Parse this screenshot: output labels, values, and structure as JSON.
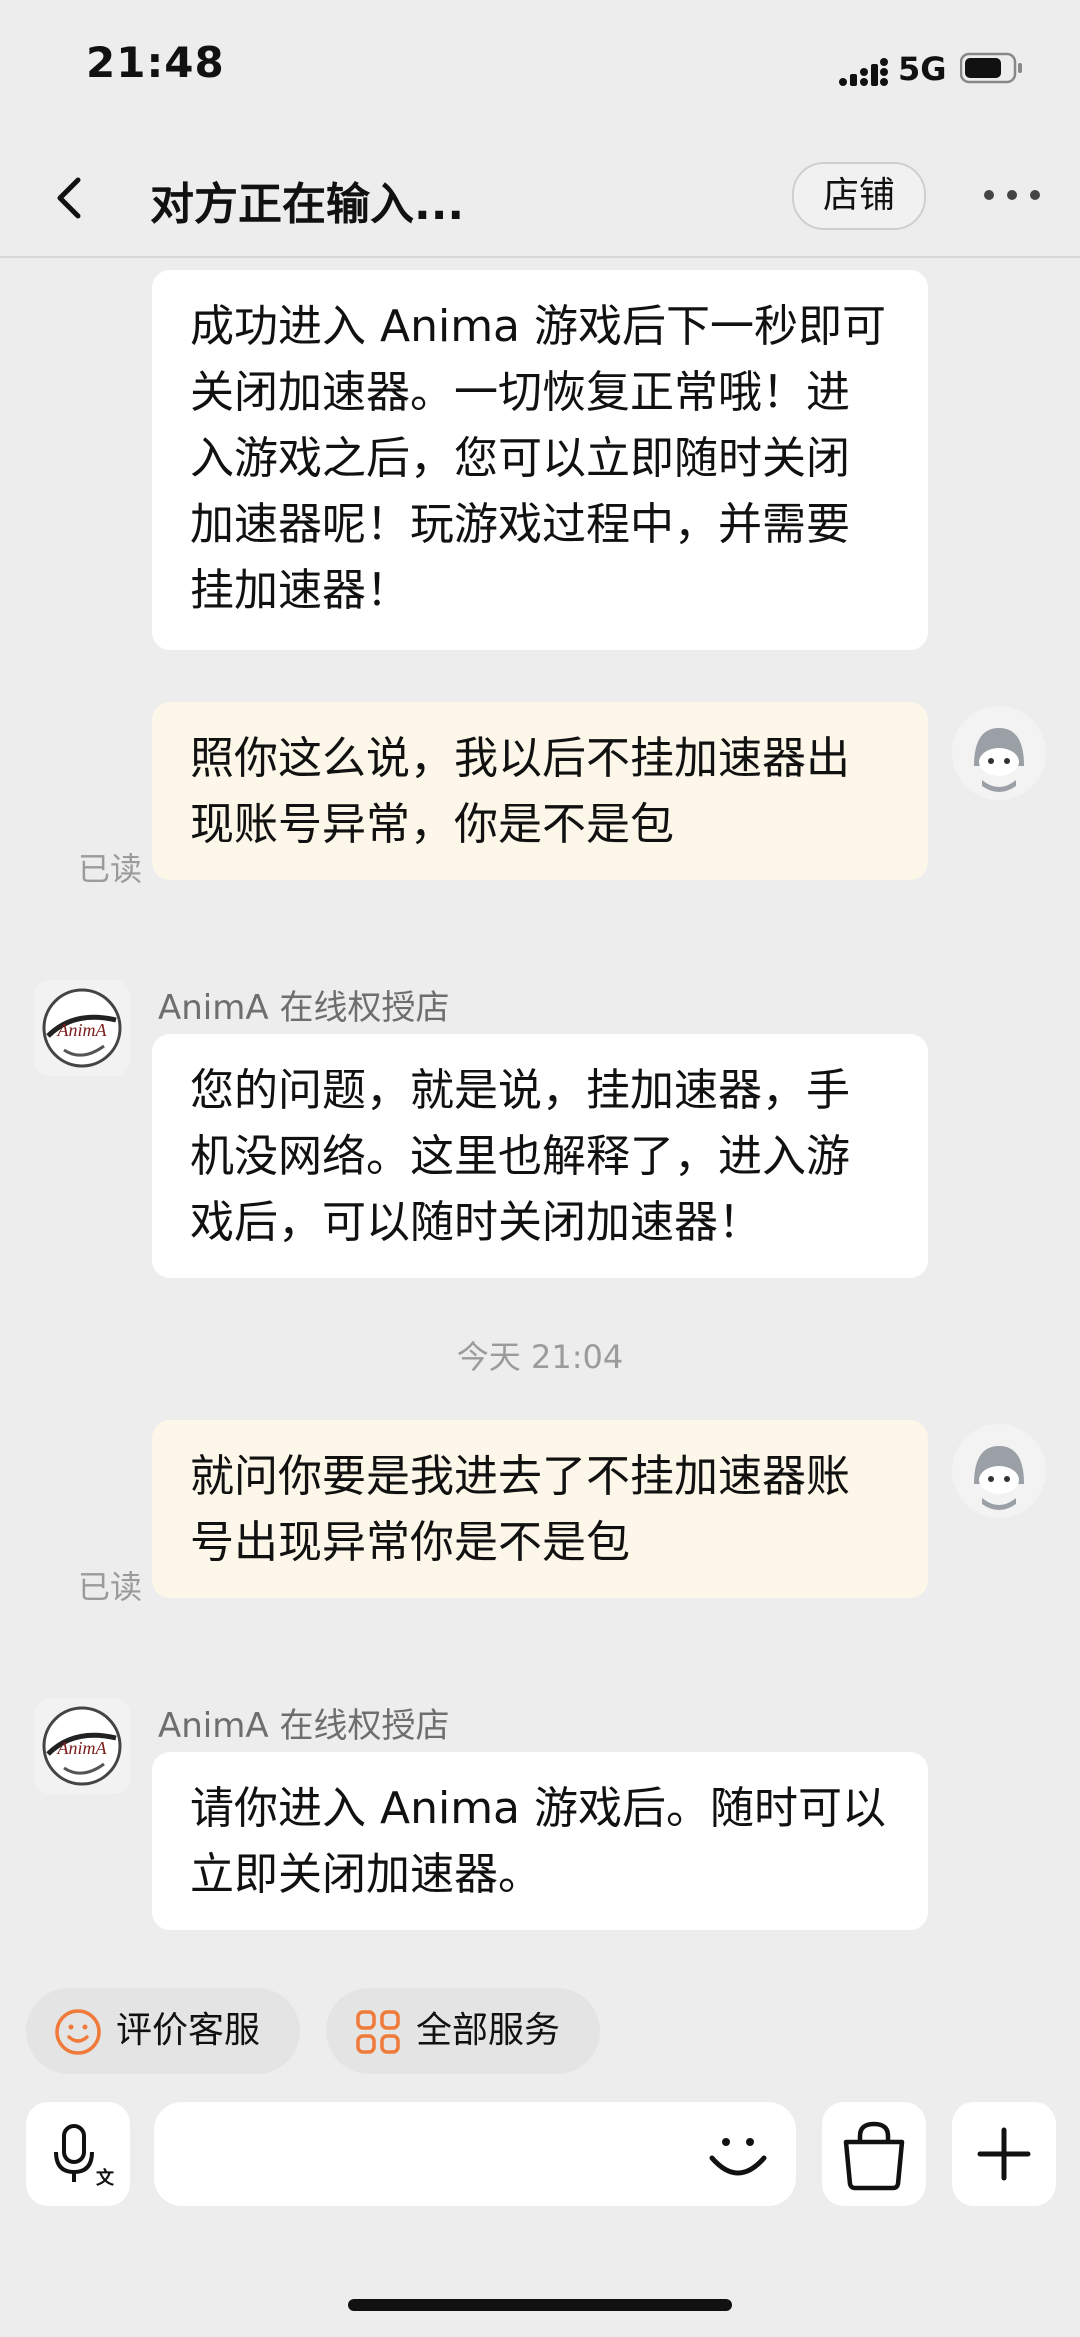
{
  "status_bar": {
    "time": "21:48",
    "network": "5G"
  },
  "header": {
    "title": "对方正在输入...",
    "shop_button": "店铺"
  },
  "messages": [
    {
      "direction": "incoming",
      "text": "成功进入 Anima 游戏后下一秒即可关闭加速器。一切恢复正常哦！进入游戏之后，您可以立即随时关闭加速器呢！玩游戏过程中，并需要挂加速器！"
    },
    {
      "direction": "outgoing",
      "text": "照你这么说，我以后不挂加速器出现账号异常，你是不是包",
      "read_status": "已读"
    },
    {
      "direction": "incoming",
      "sender": "AnimA 在线权授店",
      "text": "您的问题，就是说，挂加速器，手机没网络。这里也解释了，进入游戏后，可以随时关闭加速器！"
    },
    {
      "direction": "outgoing",
      "text": "就问你要是我进去了不挂加速器账号出现异常你是不是包",
      "read_status": "已读"
    },
    {
      "direction": "incoming",
      "sender": "AnimA 在线权授店",
      "text": "请你进入 Anima 游戏后。随时可以立即关闭加速器。"
    }
  ],
  "time_divider": "今天 21:04",
  "shop_avatar_text": "AnimA",
  "quick_actions": [
    {
      "label": "评价客服",
      "icon": "smile-icon"
    },
    {
      "label": "全部服务",
      "icon": "grid-icon"
    }
  ],
  "input": {
    "placeholder": ""
  },
  "colors": {
    "accent": "#f07a3a",
    "incoming_bubble": "#ffffff",
    "outgoing_bubble": "#fcf7e8",
    "background": "#ededed"
  }
}
